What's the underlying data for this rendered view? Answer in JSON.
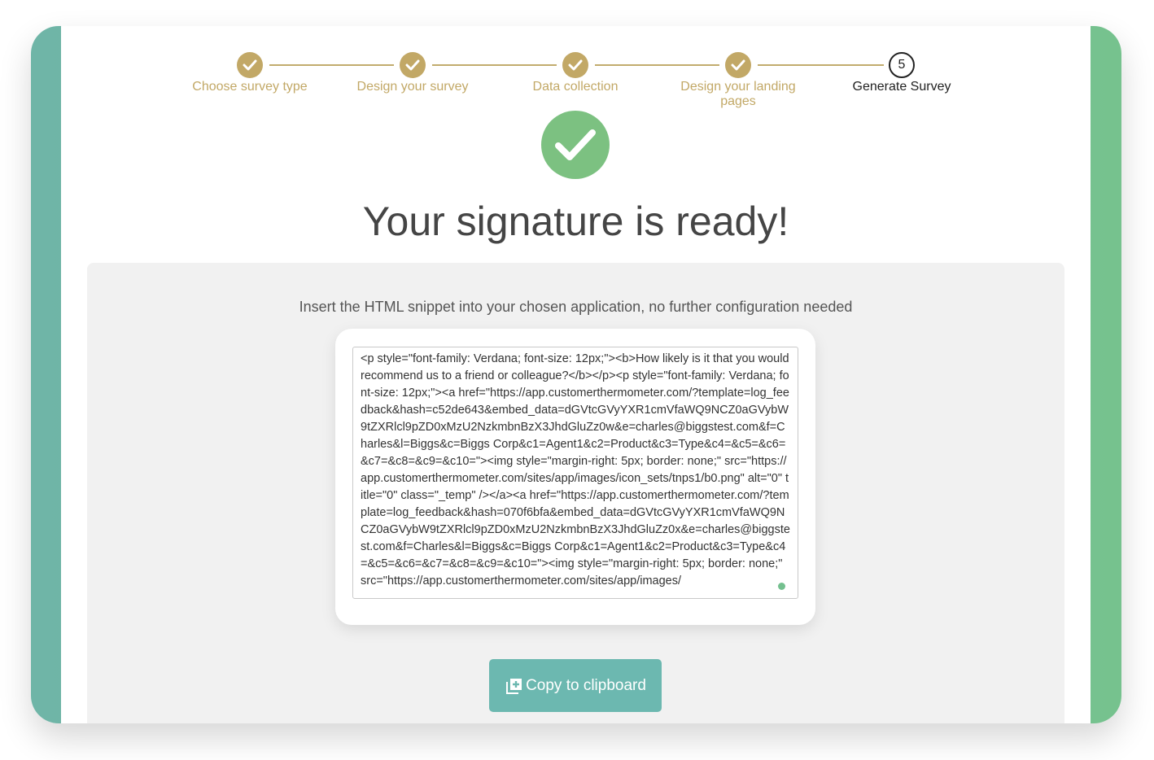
{
  "steps": [
    {
      "label": "Choose survey type",
      "state": "done"
    },
    {
      "label": "Design your survey",
      "state": "done"
    },
    {
      "label": "Data collection",
      "state": "done"
    },
    {
      "label": "Design your landing pages",
      "state": "done"
    },
    {
      "label": "Generate Survey",
      "state": "current",
      "number": "5"
    }
  ],
  "heading": "Your signature is ready!",
  "instruction": "Insert the HTML snippet into your chosen application, no further configuration needed",
  "snippet": "<p style=\"font-family: Verdana; font-size: 12px;\"><b>How likely is it that you would recommend us to a friend or colleague?</b></p><p style=\"font-family: Verdana; font-size: 12px;\"><a href=\"https://app.customerthermometer.com/?template=log_feedback&hash=c52de643&embed_data=dGVtcGVyYXR1cmVfaWQ9NCZ0aGVybW9tZXRlcl9pZD0xMzU2NzkmbnBzX3JhdGluZz0w&e=charles@biggstest.com&f=Charles&l=Biggs&c=Biggs Corp&c1=Agent1&c2=Product&c3=Type&c4=&c5=&c6=&c7=&c8=&c9=&c10=\"><img style=\"margin-right: 5px; border: none;\" src=\"https://app.customerthermometer.com/sites/app/images/icon_sets/tnps1/b0.png\" alt=\"0\" title=\"0\" class=\"_temp\" /></a><a href=\"https://app.customerthermometer.com/?template=log_feedback&hash=070f6bfa&embed_data=dGVtcGVyYXR1cmVfaWQ9NCZ0aGVybW9tZXRlcl9pZD0xMzU2NzkmbnBzX3JhdGluZz0x&e=charles@biggstest.com&f=Charles&l=Biggs&c=Biggs Corp&c1=Agent1&c2=Product&c3=Type&c4=&c5=&c6=&c7=&c8=&c9=&c10=\"><img style=\"margin-right: 5px; border: none;\" src=\"https://app.customerthermometer.com/sites/app/images/",
  "copy_button": "Copy to clipboard",
  "colors": {
    "step_done": "#c2a866",
    "success": "#7cc181",
    "button": "#6cb8b0",
    "frame_left": "#6fb5a7",
    "frame_right": "#76c28e"
  },
  "icons": {
    "step_done": "check-icon",
    "success": "check-icon",
    "copy": "copy-plus-icon"
  }
}
